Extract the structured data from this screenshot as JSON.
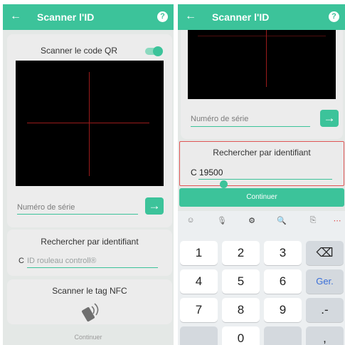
{
  "left": {
    "appbar": {
      "back_icon": "←",
      "title": "Scanner l'ID",
      "help_icon": "?"
    },
    "qr": {
      "label": "Scanner le code QR",
      "toggle_on": true
    },
    "serial": {
      "placeholder": "Numéro de série",
      "go_icon": "→"
    },
    "search": {
      "label": "Rechercher par identifiant",
      "prefix": "C",
      "placeholder": "ID rouleau controll®"
    },
    "nfc": {
      "label": "Scanner le tag NFC",
      "icon": "nfc-phone-icon"
    },
    "footer": {
      "continue_label": "Continuer"
    }
  },
  "right": {
    "appbar": {
      "back_icon": "←",
      "title": "Scanner l'ID",
      "help_icon": "?"
    },
    "serial": {
      "placeholder": "Numéro de série",
      "go_icon": "→"
    },
    "search": {
      "label": "Rechercher par identifiant",
      "value": "C 19500"
    },
    "continue_label": "Continuer",
    "keyboard": {
      "tools": [
        "☺",
        "🎙",
        "⚙",
        "🔍",
        "⎘",
        "⋯"
      ],
      "rows": [
        [
          "1",
          "2",
          "3",
          "⌫"
        ],
        [
          "4",
          "5",
          "6",
          "Ger."
        ],
        [
          "7",
          "8",
          "9",
          ".-"
        ],
        [
          "",
          "0",
          "",
          ","
        ]
      ]
    }
  },
  "colors": {
    "accent": "#3cc39a",
    "highlight": "#e05555",
    "camera": "#000000",
    "crosshair": "#9a1b1b"
  }
}
